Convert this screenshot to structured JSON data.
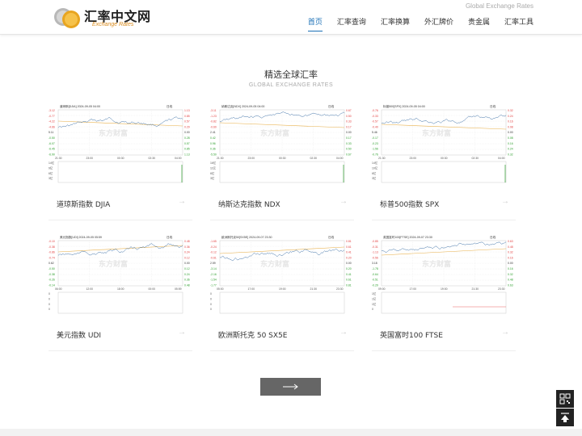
{
  "header": {
    "logo_title": "汇率中文网",
    "logo_sub": "Exchange Rates",
    "tagline": "Global Exchange Rates",
    "nav": [
      {
        "label": "首页",
        "active": true
      },
      {
        "label": "汇率查询",
        "active": false
      },
      {
        "label": "汇率换算",
        "active": false
      },
      {
        "label": "外汇牌价",
        "active": false
      },
      {
        "label": "贵金属",
        "active": false
      },
      {
        "label": "汇率工具",
        "active": false
      }
    ]
  },
  "section": {
    "title": "精选全球汇率",
    "subtitle": "GLOBAL EXCHANGE RATES"
  },
  "cards": [
    {
      "label": "道琼斯指数 DJIA",
      "chart_header": "道琼斯[DJIA]  2024-09-05 04:00",
      "chart_type": "日线",
      "x_ticks": [
        "21:30",
        "23:00",
        "00:30",
        "02:30",
        "04:00"
      ],
      "y_left": [
        "-3.12",
        "-0.77",
        "-4.22",
        "-4.66",
        "5.11",
        "-0.50",
        "-6.07",
        "-6.45",
        "-6.90"
      ],
      "y_right": [
        "1.13",
        "0.85",
        "0.57",
        "0.29",
        "0.00",
        "0.28",
        "0.57",
        "0.85",
        "1.13"
      ],
      "vol_labels": [
        "14亿",
        "9亿",
        "6亿",
        "3亿"
      ]
    },
    {
      "label": "纳斯达克指数 NDX",
      "chart_header": "纳斯达克[NDX]  2024-09-05 04:00",
      "chart_type": "日线",
      "x_ticks": [
        "21:30",
        "23:00",
        "00:30",
        "02:30",
        "04:00"
      ],
      "y_left": [
        "-3.11",
        "-1.23",
        "-0.82",
        "-0.60",
        "2.41",
        "0.42",
        "0.96",
        "0.36",
        "-5.50"
      ],
      "y_right": [
        "0.67",
        "0.50",
        "0.33",
        "0.17",
        "0.00",
        "0.17",
        "0.33",
        "0.50",
        "0.67"
      ],
      "vol_labels": [
        "16亿",
        "11亿",
        "6亿",
        "3亿"
      ]
    },
    {
      "label": "标普500指数 SPX",
      "chart_header": "标普500[SPX]  2024-09-05 04:00",
      "chart_type": "日线",
      "x_ticks": [
        "21:30",
        "23:00",
        "00:30",
        "02:30",
        "04:00"
      ],
      "y_left": [
        "-0.76",
        "-0.33",
        "-0.57",
        "-0.40",
        "5.46",
        "-0.17",
        "-0.23",
        "-1.56",
        "-0.76"
      ],
      "y_right": [
        "0.32",
        "0.24",
        "0.16",
        "0.08",
        "0.00",
        "0.08",
        "0.16",
        "0.24",
        "0.32"
      ],
      "vol_labels": [
        "14亿",
        "10亿",
        "6亿",
        "3亿"
      ]
    },
    {
      "label": "美元指数 UDI",
      "chart_header": "美元指数[UDI]  2024-09-05 05:59",
      "chart_type": "日线",
      "x_ticks": [
        "06:00",
        "12:00",
        "18:00",
        "00:00",
        "05:59"
      ],
      "y_left": [
        "-0.10",
        "-0.38",
        "-0.86",
        "-0.74",
        "0.62",
        "-0.50",
        "-0.38",
        "-0.26",
        "-0.14"
      ],
      "y_right": [
        "0.48",
        "0.36",
        "0.24",
        "0.12",
        "0.00",
        "0.12",
        "0.24",
        "0.36",
        "0.48"
      ],
      "vol_labels": [
        "0",
        "0",
        "0",
        "0"
      ]
    },
    {
      "label": "欧洲斯托克 50 SX5E",
      "chart_header": "欧洲斯托克50[SX5E]  2024-09-07 23:30",
      "chart_type": "日线",
      "x_ticks": [
        "05:00",
        "17:00",
        "19:00",
        "21:30",
        "23:30"
      ],
      "y_left": [
        "-1.65",
        "-0.24",
        "-0.12",
        "-0.61",
        "2.59",
        "-3.14",
        "-2.16",
        "-1.54",
        "-1.77"
      ],
      "y_right": [
        "0.81",
        "0.61",
        "0.41",
        "0.20",
        "0.00",
        "0.20",
        "0.41",
        "0.61",
        "0.81"
      ],
      "vol_labels": [
        "0",
        "0",
        "0",
        "0"
      ]
    },
    {
      "label": "英国富时100 FTSE",
      "chart_header": "英国富时100[FTSE]  2024-09-07 23:30",
      "chart_type": "日线",
      "x_ticks": [
        "09:00",
        "17:00",
        "19:00",
        "21:30",
        "23:30"
      ],
      "y_left": [
        "-0.85",
        "-0.31",
        "-1.13",
        "-0.56",
        "3.18",
        "-1.78",
        "-0.64",
        "-0.51",
        "-0.29"
      ],
      "y_right": [
        "0.63",
        "0.48",
        "0.32",
        "0.16",
        "0.00",
        "0.16",
        "0.32",
        "0.48",
        "0.63"
      ],
      "vol_labels": [
        "1亿",
        "1亿",
        "1亿",
        "0"
      ]
    }
  ],
  "colors": {
    "accent": "#1a6fb5",
    "up": "#e23c3c",
    "down": "#2a9d2a",
    "line": "#3a6ea5",
    "avg": "#e8b04b"
  }
}
